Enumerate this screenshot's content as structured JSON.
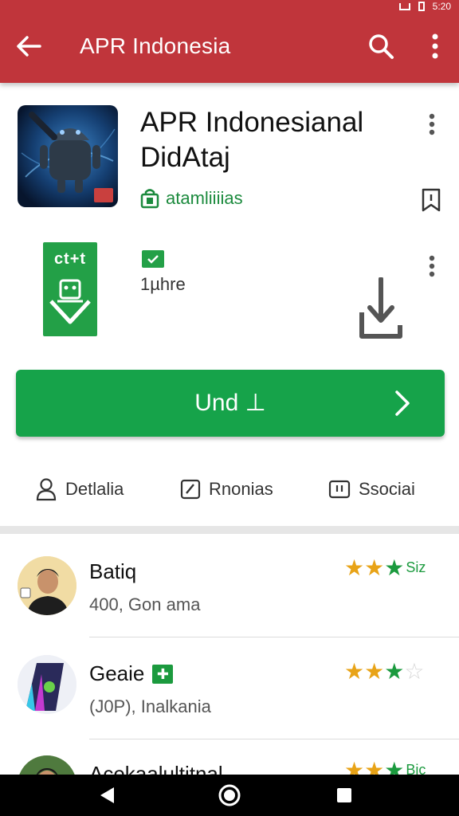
{
  "status_bar": {
    "time": "5:20"
  },
  "app_bar": {
    "title": "APR Indonesia",
    "icons": {
      "back": "arrow-back-icon",
      "search": "search-icon",
      "overflow": "more-vert-icon"
    }
  },
  "app": {
    "title_line1": "APR Indonesianal",
    "title_line2": "DidAtaj",
    "developer": "atamliiiias",
    "icon_name": "android-robot-app-icon"
  },
  "secondary": {
    "icon_label": "ct+t",
    "size": "1µhre",
    "icons": {
      "badge": "check-badge-icon",
      "download": "download-icon",
      "menu": "more-vert-icon"
    }
  },
  "install_button": {
    "label": "Und ⊥"
  },
  "tabs": [
    {
      "label": "Detlalia",
      "icon": "person-icon"
    },
    {
      "label": "Rnonias",
      "icon": "edit-icon"
    },
    {
      "label": "Ssociai",
      "icon": "social-icon"
    }
  ],
  "list_items": [
    {
      "name": "Batiq",
      "subtitle": "400, Gon ama",
      "rating": 3,
      "rating_label": "Siz",
      "badge": false
    },
    {
      "name": "Geaie",
      "subtitle": "(J0P), Inalkania",
      "rating": 3,
      "rating_label": "",
      "badge": true
    },
    {
      "name": "Acekaalultitnal",
      "subtitle": "",
      "rating": 3,
      "rating_label": "Bic",
      "badge": false
    }
  ],
  "colors": {
    "app_bar": "#c0353b",
    "accent_green": "#16a34a",
    "star_yellow": "#e8a317",
    "star_green": "#1b9a3e"
  },
  "nav": {
    "icons": [
      "back-triangle-icon",
      "home-circle-icon",
      "recents-square-icon"
    ]
  }
}
